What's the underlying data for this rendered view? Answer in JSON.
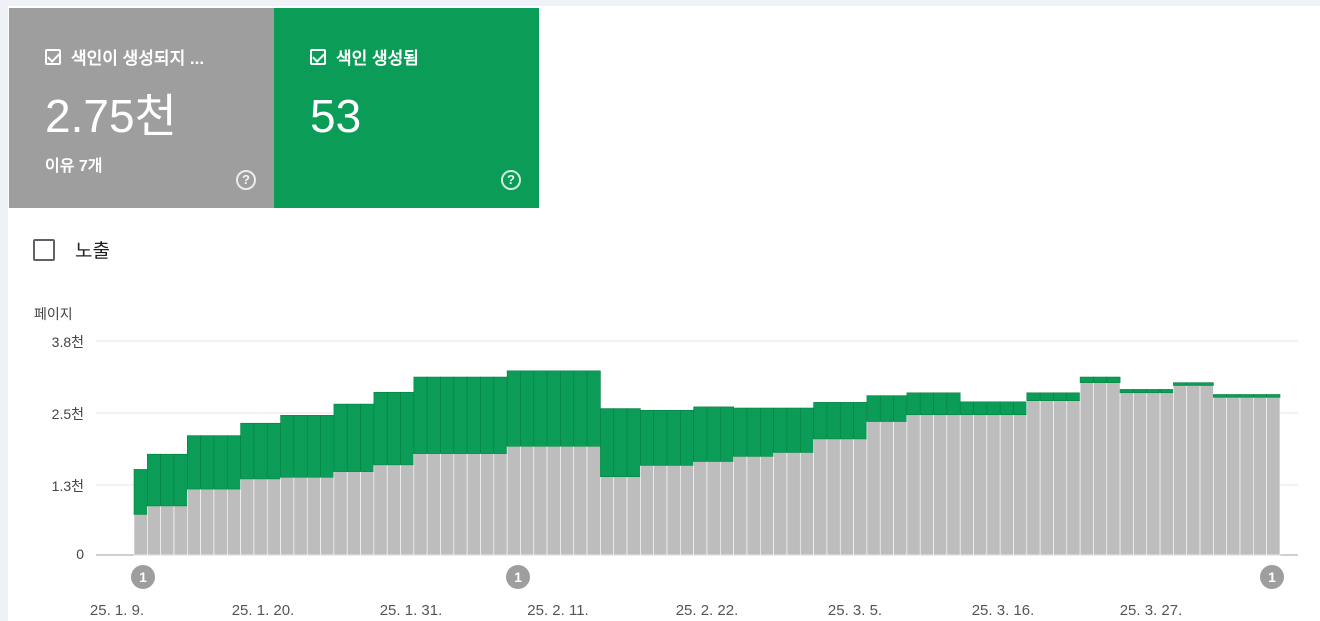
{
  "cards": {
    "not_indexed": {
      "label": "색인이 생성되지 ...",
      "value": "2.75천",
      "sub": "이유 7개",
      "help": "?",
      "color": "#9e9e9e",
      "checked": true
    },
    "indexed": {
      "label": "색인 생성됨",
      "value": "53",
      "help": "?",
      "color": "#0b9d58",
      "checked": true
    }
  },
  "impressions": {
    "label": "노출",
    "checked": false
  },
  "chart_data": {
    "type": "bar",
    "stacked": true,
    "ylabel": "페이지",
    "y_ticks": [
      "0",
      "1.3천",
      "2.5천",
      "3.8천"
    ],
    "ylim": [
      0,
      3800
    ],
    "grid": true,
    "x_ticks": [
      "25. 1. 9.",
      "25. 1. 20.",
      "25. 1. 31.",
      "25. 2. 11.",
      "25. 2. 22.",
      "25. 3. 5.",
      "25. 3. 16.",
      "25. 3. 27."
    ],
    "annotations": [
      {
        "date": "25. 1. 9.",
        "label": "1"
      },
      {
        "date": "25. 2. 6.",
        "label": "1"
      },
      {
        "date": "25. 4. 1.",
        "label": "1"
      }
    ],
    "series": [
      {
        "name": "색인이 생성되지 않음",
        "color": "#bdbdbd",
        "values": [
          720,
          870,
          870,
          870,
          1170,
          1170,
          1170,
          1170,
          1350,
          1350,
          1350,
          1380,
          1380,
          1380,
          1380,
          1480,
          1480,
          1480,
          1600,
          1600,
          1600,
          1800,
          1800,
          1800,
          1800,
          1800,
          1800,
          1800,
          1930,
          1930,
          1930,
          1930,
          1930,
          1930,
          1930,
          1390,
          1390,
          1390,
          1590,
          1590,
          1590,
          1590,
          1660,
          1660,
          1660,
          1750,
          1750,
          1750,
          1820,
          1820,
          1820,
          2060,
          2060,
          2060,
          2060,
          2370,
          2370,
          2370,
          2490,
          2490,
          2490,
          2490,
          2490,
          2490,
          2490,
          2490,
          2490,
          2740,
          2740,
          2740,
          2740,
          3060,
          3060,
          3060,
          2880,
          2880,
          2880,
          2880,
          3010,
          3010,
          3010,
          2800,
          2800,
          2800,
          2800,
          2800
        ]
      },
      {
        "name": "색인 생성됨",
        "color": "#0b9d58",
        "values": [
          800,
          920,
          920,
          920,
          950,
          950,
          950,
          950,
          990,
          990,
          990,
          1100,
          1100,
          1100,
          1100,
          1200,
          1200,
          1200,
          1290,
          1290,
          1290,
          1360,
          1360,
          1360,
          1360,
          1360,
          1360,
          1360,
          1340,
          1340,
          1340,
          1340,
          1340,
          1340,
          1340,
          1210,
          1210,
          1210,
          980,
          980,
          980,
          980,
          970,
          970,
          970,
          860,
          860,
          860,
          790,
          790,
          790,
          650,
          650,
          650,
          650,
          460,
          460,
          460,
          390,
          390,
          390,
          390,
          230,
          230,
          230,
          230,
          230,
          140,
          140,
          140,
          140,
          100,
          100,
          100,
          60,
          60,
          60,
          60,
          50,
          50,
          50,
          50,
          50,
          50,
          50,
          50
        ]
      }
    ]
  }
}
